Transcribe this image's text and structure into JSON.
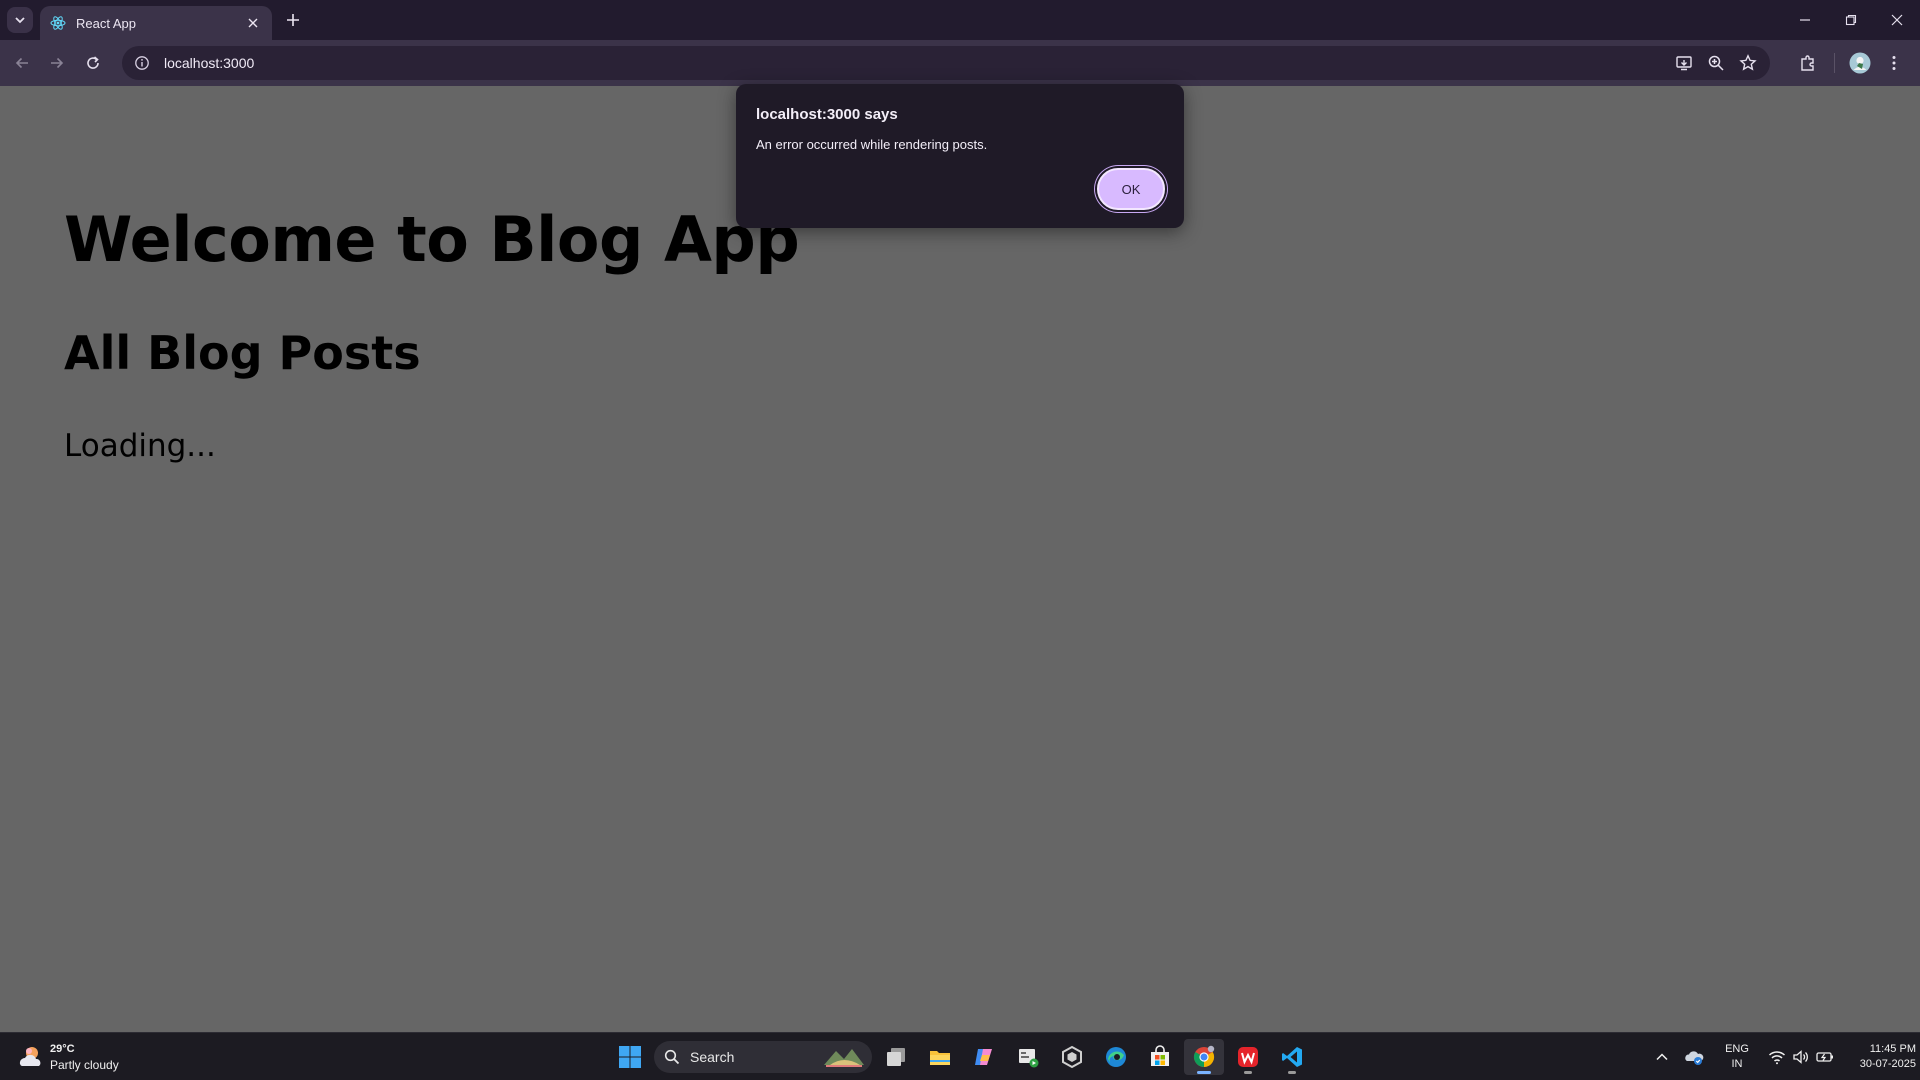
{
  "browser": {
    "tab_title": "React App",
    "url": "localhost:3000"
  },
  "page": {
    "heading": "Welcome to Blog App",
    "subheading": "All Blog Posts",
    "status": "Loading..."
  },
  "dialog": {
    "title": "localhost:3000 says",
    "message": "An error occurred while rendering posts.",
    "ok_label": "OK"
  },
  "taskbar": {
    "weather": {
      "temp": "29°C",
      "condition": "Partly cloudy"
    },
    "search_label": "Search",
    "lang_line1": "ENG",
    "lang_line2": "IN",
    "time": "11:45 PM",
    "date": "30-07-2025"
  },
  "colors": {
    "page_background": "#666666",
    "dialog_background": "#1f1a27",
    "ok_button": "#d8baff",
    "titlebar": "#221b2e",
    "toolbar": "#3b3349"
  },
  "icons": [
    "tab-search-icon",
    "react-favicon-icon",
    "close-icon",
    "plus-icon",
    "minimize-icon",
    "restore-icon",
    "back-icon",
    "forward-icon",
    "reload-icon",
    "site-info-icon",
    "install-app-icon",
    "zoom-icon",
    "bookmark-star-icon",
    "extensions-icon",
    "profile-avatar",
    "menu-icon",
    "weather-icon",
    "windows-start-icon",
    "search-icon",
    "task-view-icon",
    "file-explorer-icon",
    "copilot-icon",
    "app-icon",
    "edge-icon",
    "store-icon",
    "chrome-icon",
    "wps-icon",
    "vscode-icon",
    "chevron-up-icon",
    "onedrive-icon",
    "wifi-icon",
    "volume-icon",
    "battery-icon"
  ]
}
